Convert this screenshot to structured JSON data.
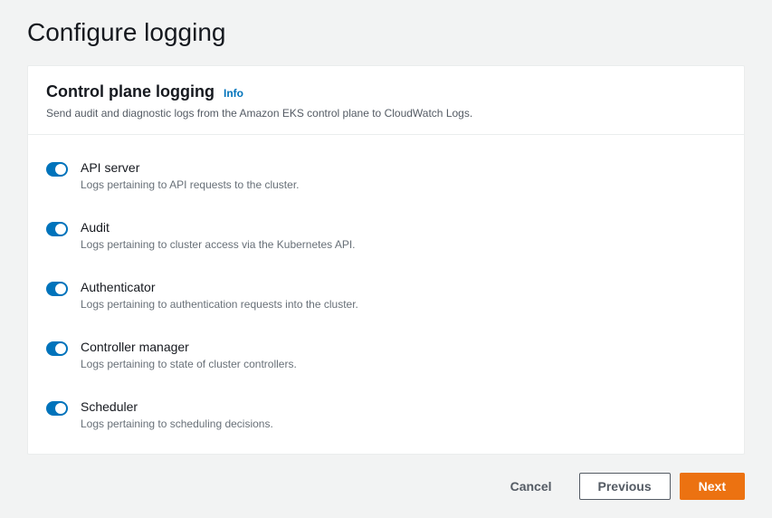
{
  "page": {
    "title": "Configure logging"
  },
  "panel": {
    "title": "Control plane logging",
    "info_label": "Info",
    "description": "Send audit and diagnostic logs from the Amazon EKS control plane to CloudWatch Logs."
  },
  "toggles": [
    {
      "label": "API server",
      "description": "Logs pertaining to API requests to the cluster.",
      "enabled": true
    },
    {
      "label": "Audit",
      "description": "Logs pertaining to cluster access via the Kubernetes API.",
      "enabled": true
    },
    {
      "label": "Authenticator",
      "description": "Logs pertaining to authentication requests into the cluster.",
      "enabled": true
    },
    {
      "label": "Controller manager",
      "description": "Logs pertaining to state of cluster controllers.",
      "enabled": true
    },
    {
      "label": "Scheduler",
      "description": "Logs pertaining to scheduling decisions.",
      "enabled": true
    }
  ],
  "footer": {
    "cancel": "Cancel",
    "previous": "Previous",
    "next": "Next"
  }
}
